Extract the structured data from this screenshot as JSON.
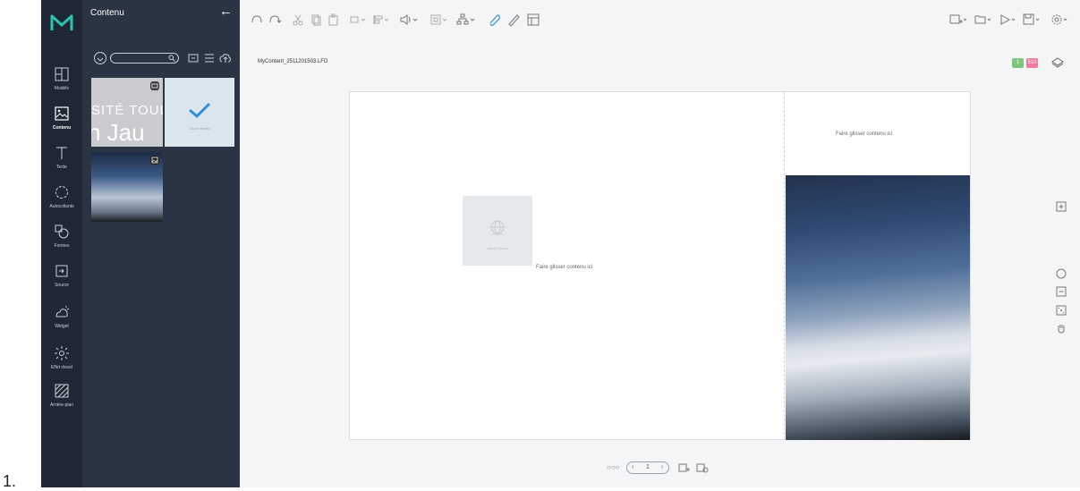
{
  "outer_list_number": "1.",
  "sidebar": {
    "items": [
      {
        "label": "Modèle",
        "icon": "layout-icon"
      },
      {
        "label": "Contenu",
        "icon": "image-icon",
        "active": true
      },
      {
        "label": "Texte",
        "icon": "text-icon"
      },
      {
        "label": "Autocollants",
        "icon": "sticker-icon"
      },
      {
        "label": "Formes",
        "icon": "shapes-icon"
      },
      {
        "label": "Source",
        "icon": "source-icon"
      },
      {
        "label": "Widget",
        "icon": "weather-icon"
      },
      {
        "label": "Effet visuel",
        "icon": "effect-icon"
      },
      {
        "label": "Arrière-plan",
        "icon": "background-icon"
      }
    ]
  },
  "panel": {
    "title": "Contenu",
    "back_glyph": "←",
    "thumbnails": [
      {
        "line1": "SITÉ TOUL",
        "line2": "n Jau"
      },
      {
        "tag": "Saved Media"
      },
      {
        "kind": "sky-photo"
      }
    ]
  },
  "document": {
    "filename": "MyContent_2511201503.LFD",
    "page_badge": "1",
    "size_badge": "510",
    "badge_colors": {
      "page": "#7cc57a",
      "size": "#f07aa0"
    }
  },
  "canvas": {
    "drop_text_left": "Faire glisser contenu ici",
    "drop_text_right": "Faire glisser contenu ici",
    "placeholder_tag": "Saved Media"
  },
  "footer": {
    "dots": "○○○",
    "page_number": "1",
    "prev_glyph": "‹",
    "next_glyph": "›"
  },
  "colors": {
    "rail_bg": "#1f2734",
    "panel_bg": "#2b3442",
    "accent_blue": "#2f8fd8"
  }
}
